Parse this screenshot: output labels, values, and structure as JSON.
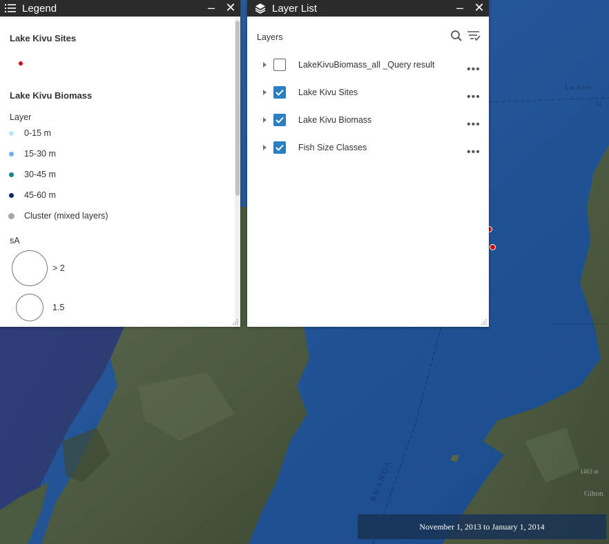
{
  "legend": {
    "title": "Legend",
    "minimize_symbol": "–",
    "close_symbol": "✕",
    "sites_title": "Lake Kivu Sites",
    "sites_color": "#d90000",
    "biomass_title": "Lake Kivu Biomass",
    "layer_label": "Layer",
    "layer_classes": [
      {
        "label": "0-15 m",
        "color": "#bfe3ff"
      },
      {
        "label": "15-30 m",
        "color": "#6fb0f0"
      },
      {
        "label": "30-45 m",
        "color": "#14828f"
      },
      {
        "label": "45-60 m",
        "color": "#0b2a6b"
      },
      {
        "label": "Cluster (mixed layers)",
        "color": "#a8a8a8"
      }
    ],
    "sa_label": "sA",
    "sa_classes": [
      {
        "label": "> 2"
      },
      {
        "label": "1.5"
      }
    ]
  },
  "layer_list": {
    "title": "Layer List",
    "minimize_symbol": "–",
    "close_symbol": "✕",
    "layers_label": "Layers",
    "search_icon": "search-icon",
    "filter_icon": "filter-list-icon",
    "layers": [
      {
        "name": "LakeKivuBiomass_all _Query result",
        "checked": false
      },
      {
        "name": "Lake Kivu Sites",
        "checked": true
      },
      {
        "name": "Lake Kivu Biomass",
        "checked": true
      },
      {
        "name": "Fish Size Classes",
        "checked": true
      }
    ],
    "more_symbol": "•••"
  },
  "map": {
    "label_rwanda": "RWANDA",
    "label_kivu": "Lac Kivu",
    "label_kivu_short": "K",
    "label_gih": "Gihon",
    "label_elev": "1463 m",
    "water_color": "#1f4f8f",
    "land_color": "#4a5a3e"
  },
  "time_slider": {
    "range_text": "November 1, 2013 to January 1, 2014"
  }
}
